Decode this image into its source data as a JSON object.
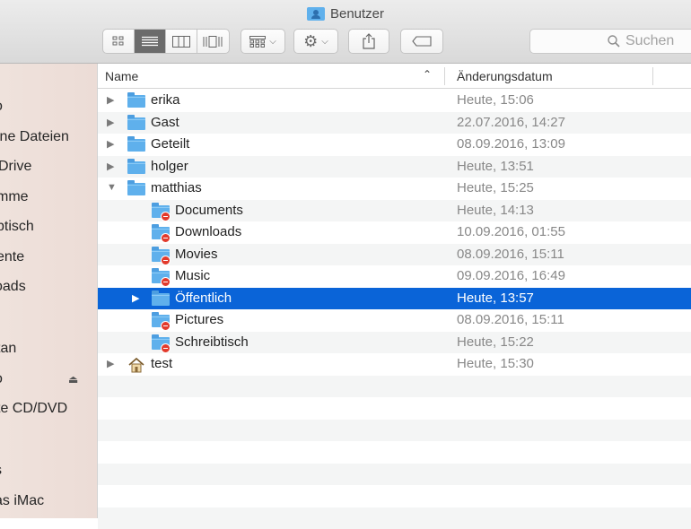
{
  "window": {
    "title": "Benutzer"
  },
  "toolbar": {
    "view_icons": [
      "icon-view-icon",
      "list-view-icon",
      "column-view-icon",
      "coverflow-view-icon"
    ],
    "active_view": 1,
    "search_placeholder": "Suchen"
  },
  "sidebar": {
    "items": [
      {
        "label": "o"
      },
      {
        "label": "ine Dateien"
      },
      {
        "label": "Drive"
      },
      {
        "label": "mme"
      },
      {
        "label": "btisch"
      },
      {
        "label": "ente"
      },
      {
        "label": "oads"
      },
      {
        "label": ""
      },
      {
        "label": "tan"
      },
      {
        "label": "o",
        "eject": true
      },
      {
        "label": "te CD/DVD"
      },
      {
        "label": ""
      },
      {
        "label": "s"
      },
      {
        "label": "as iMac"
      }
    ]
  },
  "columns": {
    "name": "Name",
    "date": "Änderungsdatum"
  },
  "colors": {
    "selection": "#0a64d8",
    "folder": "#5fb0ec",
    "badge": "#e23a2c"
  },
  "rows": [
    {
      "name": "erika",
      "date": "Heute, 15:06",
      "level": 0,
      "disclosure": "collapsed",
      "icon": "folder"
    },
    {
      "name": "Gast",
      "date": "22.07.2016, 14:27",
      "level": 0,
      "disclosure": "collapsed",
      "icon": "folder"
    },
    {
      "name": "Geteilt",
      "date": "08.09.2016, 13:09",
      "level": 0,
      "disclosure": "collapsed",
      "icon": "folder"
    },
    {
      "name": "holger",
      "date": "Heute, 13:51",
      "level": 0,
      "disclosure": "collapsed",
      "icon": "folder"
    },
    {
      "name": "matthias",
      "date": "Heute, 15:25",
      "level": 0,
      "disclosure": "expanded",
      "icon": "folder"
    },
    {
      "name": "Documents",
      "date": "Heute, 14:13",
      "level": 1,
      "disclosure": "none",
      "icon": "folder-restricted"
    },
    {
      "name": "Downloads",
      "date": "10.09.2016, 01:55",
      "level": 1,
      "disclosure": "none",
      "icon": "folder-restricted"
    },
    {
      "name": "Movies",
      "date": "08.09.2016, 15:11",
      "level": 1,
      "disclosure": "none",
      "icon": "folder-restricted"
    },
    {
      "name": "Music",
      "date": "09.09.2016, 16:49",
      "level": 1,
      "disclosure": "none",
      "icon": "folder-restricted"
    },
    {
      "name": "Öffentlich",
      "date": "Heute, 13:57",
      "level": 1,
      "disclosure": "collapsed",
      "icon": "folder",
      "selected": true
    },
    {
      "name": "Pictures",
      "date": "08.09.2016, 15:11",
      "level": 1,
      "disclosure": "none",
      "icon": "folder-restricted"
    },
    {
      "name": "Schreibtisch",
      "date": "Heute, 15:22",
      "level": 1,
      "disclosure": "none",
      "icon": "folder-restricted"
    },
    {
      "name": "test",
      "date": "Heute, 15:30",
      "level": 0,
      "disclosure": "collapsed",
      "icon": "home"
    }
  ]
}
